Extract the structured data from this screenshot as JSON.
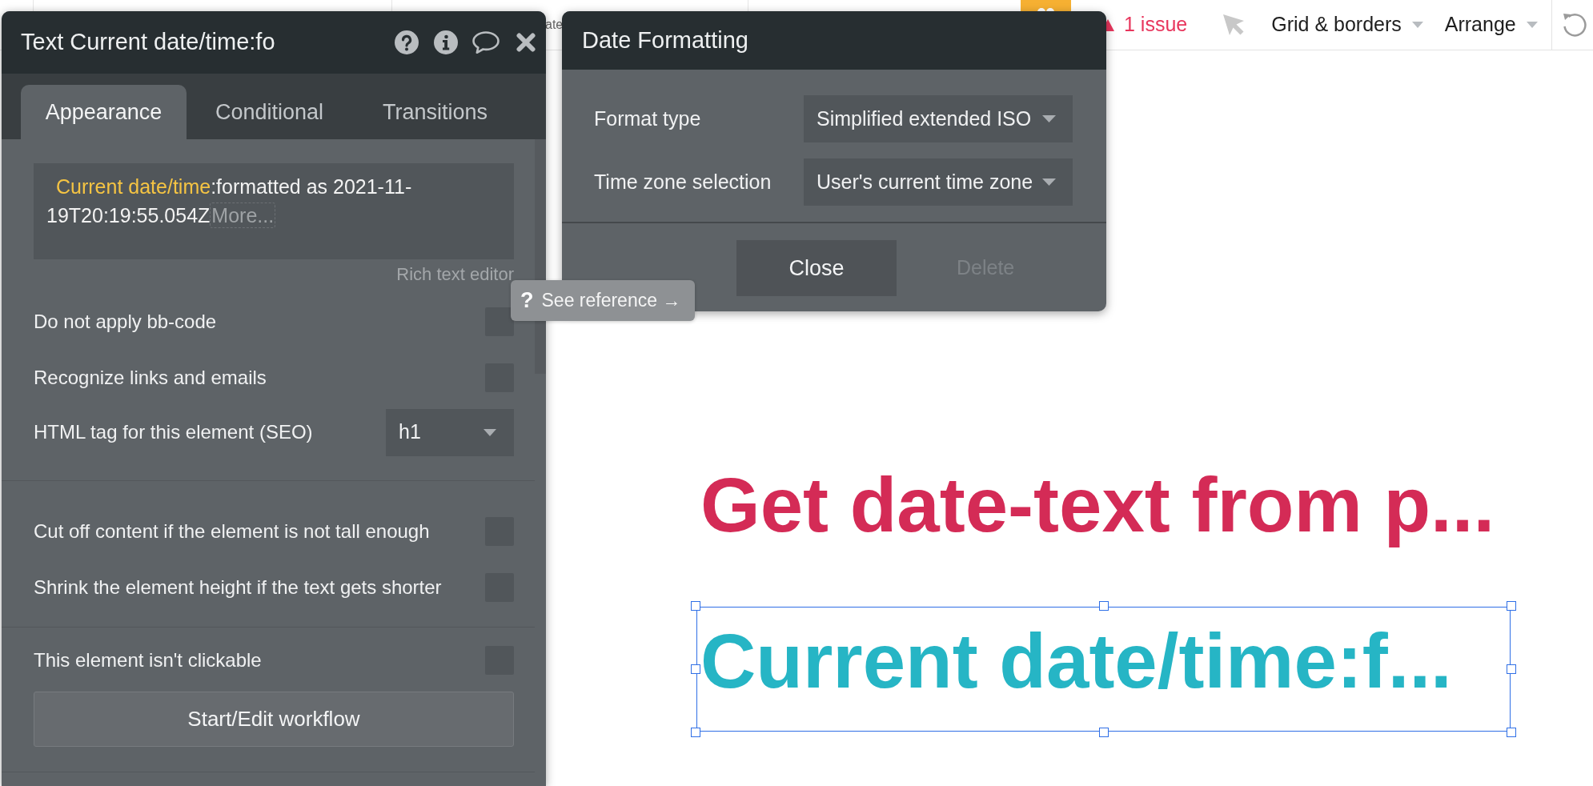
{
  "top_bar": {
    "partial_label": "ate",
    "issues": "1 issue",
    "menus": [
      {
        "label": "Grid & borders"
      },
      {
        "label": "Arrange"
      }
    ]
  },
  "property_editor": {
    "title": "Text Current date/time:fo",
    "tabs": [
      {
        "label": "Appearance",
        "selected": true
      },
      {
        "label": "Conditional",
        "selected": false
      },
      {
        "label": "Transitions",
        "selected": false
      }
    ],
    "expression": {
      "segments": [
        {
          "kind": "dynamic",
          "text": "Current date/time"
        },
        {
          "kind": "plain",
          "text": ":formatted as 2021-11-"
        },
        {
          "kind": "plain",
          "text": "19T20:19:55.054Z"
        }
      ],
      "more": "More..."
    },
    "rich_text_link": "Rich text editor",
    "sections": [
      {
        "rows": [
          {
            "kind": "checkbox",
            "label": "Do not apply bb-code",
            "checked": false
          },
          {
            "kind": "checkbox",
            "label": "Recognize links and emails",
            "checked": false
          },
          {
            "kind": "dropdown",
            "label": "HTML tag for this element (SEO)",
            "value": "h1"
          }
        ]
      },
      {
        "rows": [
          {
            "kind": "checkbox",
            "label": "Cut off content if the element is not tall enough",
            "checked": false
          },
          {
            "kind": "checkbox",
            "label": "Shrink the element height if the text gets shorter",
            "checked": false
          }
        ]
      },
      {
        "rows": [
          {
            "kind": "checkbox",
            "label": "This element isn't clickable",
            "checked": false
          },
          {
            "kind": "button",
            "label": "Start/Edit workflow"
          }
        ]
      }
    ]
  },
  "date_formatting": {
    "title": "Date Formatting",
    "fields": [
      {
        "label": "Format type",
        "value": "Simplified extended ISO"
      },
      {
        "label": "Time zone selection",
        "value": "User's current time zone"
      }
    ],
    "buttons": [
      {
        "label": "Close",
        "disabled": false
      },
      {
        "label": "Delete",
        "disabled": true
      }
    ]
  },
  "reference_tip": {
    "icon": "?",
    "label": "See reference →"
  },
  "canvas": {
    "elements": [
      {
        "text": "Get date-text from p...",
        "color": "#d42b56",
        "selected": false
      },
      {
        "text": "Current date/time:f...",
        "color": "#26b5c5",
        "selected": true
      }
    ]
  }
}
